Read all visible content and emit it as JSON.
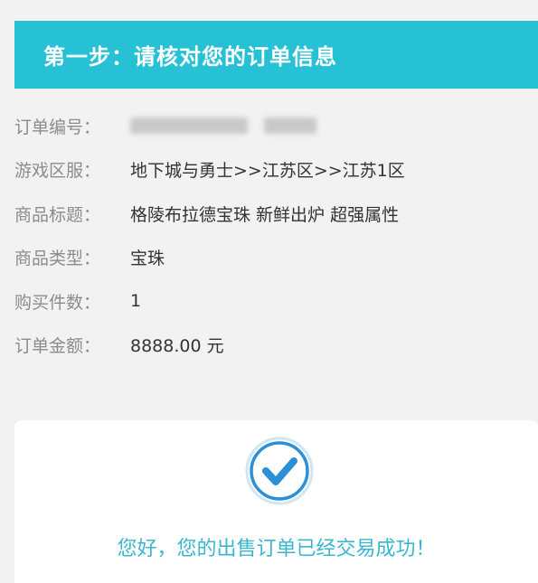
{
  "header": {
    "title": "第一步：请核对您的订单信息"
  },
  "order": {
    "rows": [
      {
        "label": "订单编号：",
        "value": ""
      },
      {
        "label": "游戏区服：",
        "value": "地下城与勇士>>江苏区>>江苏1区"
      },
      {
        "label": "商品标题：",
        "value": "格陵布拉德宝珠 新鲜出炉 超强属性"
      },
      {
        "label": "商品类型：",
        "value": "宝珠"
      },
      {
        "label": "购买件数：",
        "value": "1"
      },
      {
        "label": "订单金额：",
        "value": "8888.00 元"
      }
    ]
  },
  "success": {
    "icon": "check-circle-icon",
    "message": "您好，您的出售订单已经交易成功！"
  },
  "colors": {
    "header_bg": "#27c1d6",
    "success_text": "#3ab7cf",
    "check_icon": "#2d8fd6"
  }
}
